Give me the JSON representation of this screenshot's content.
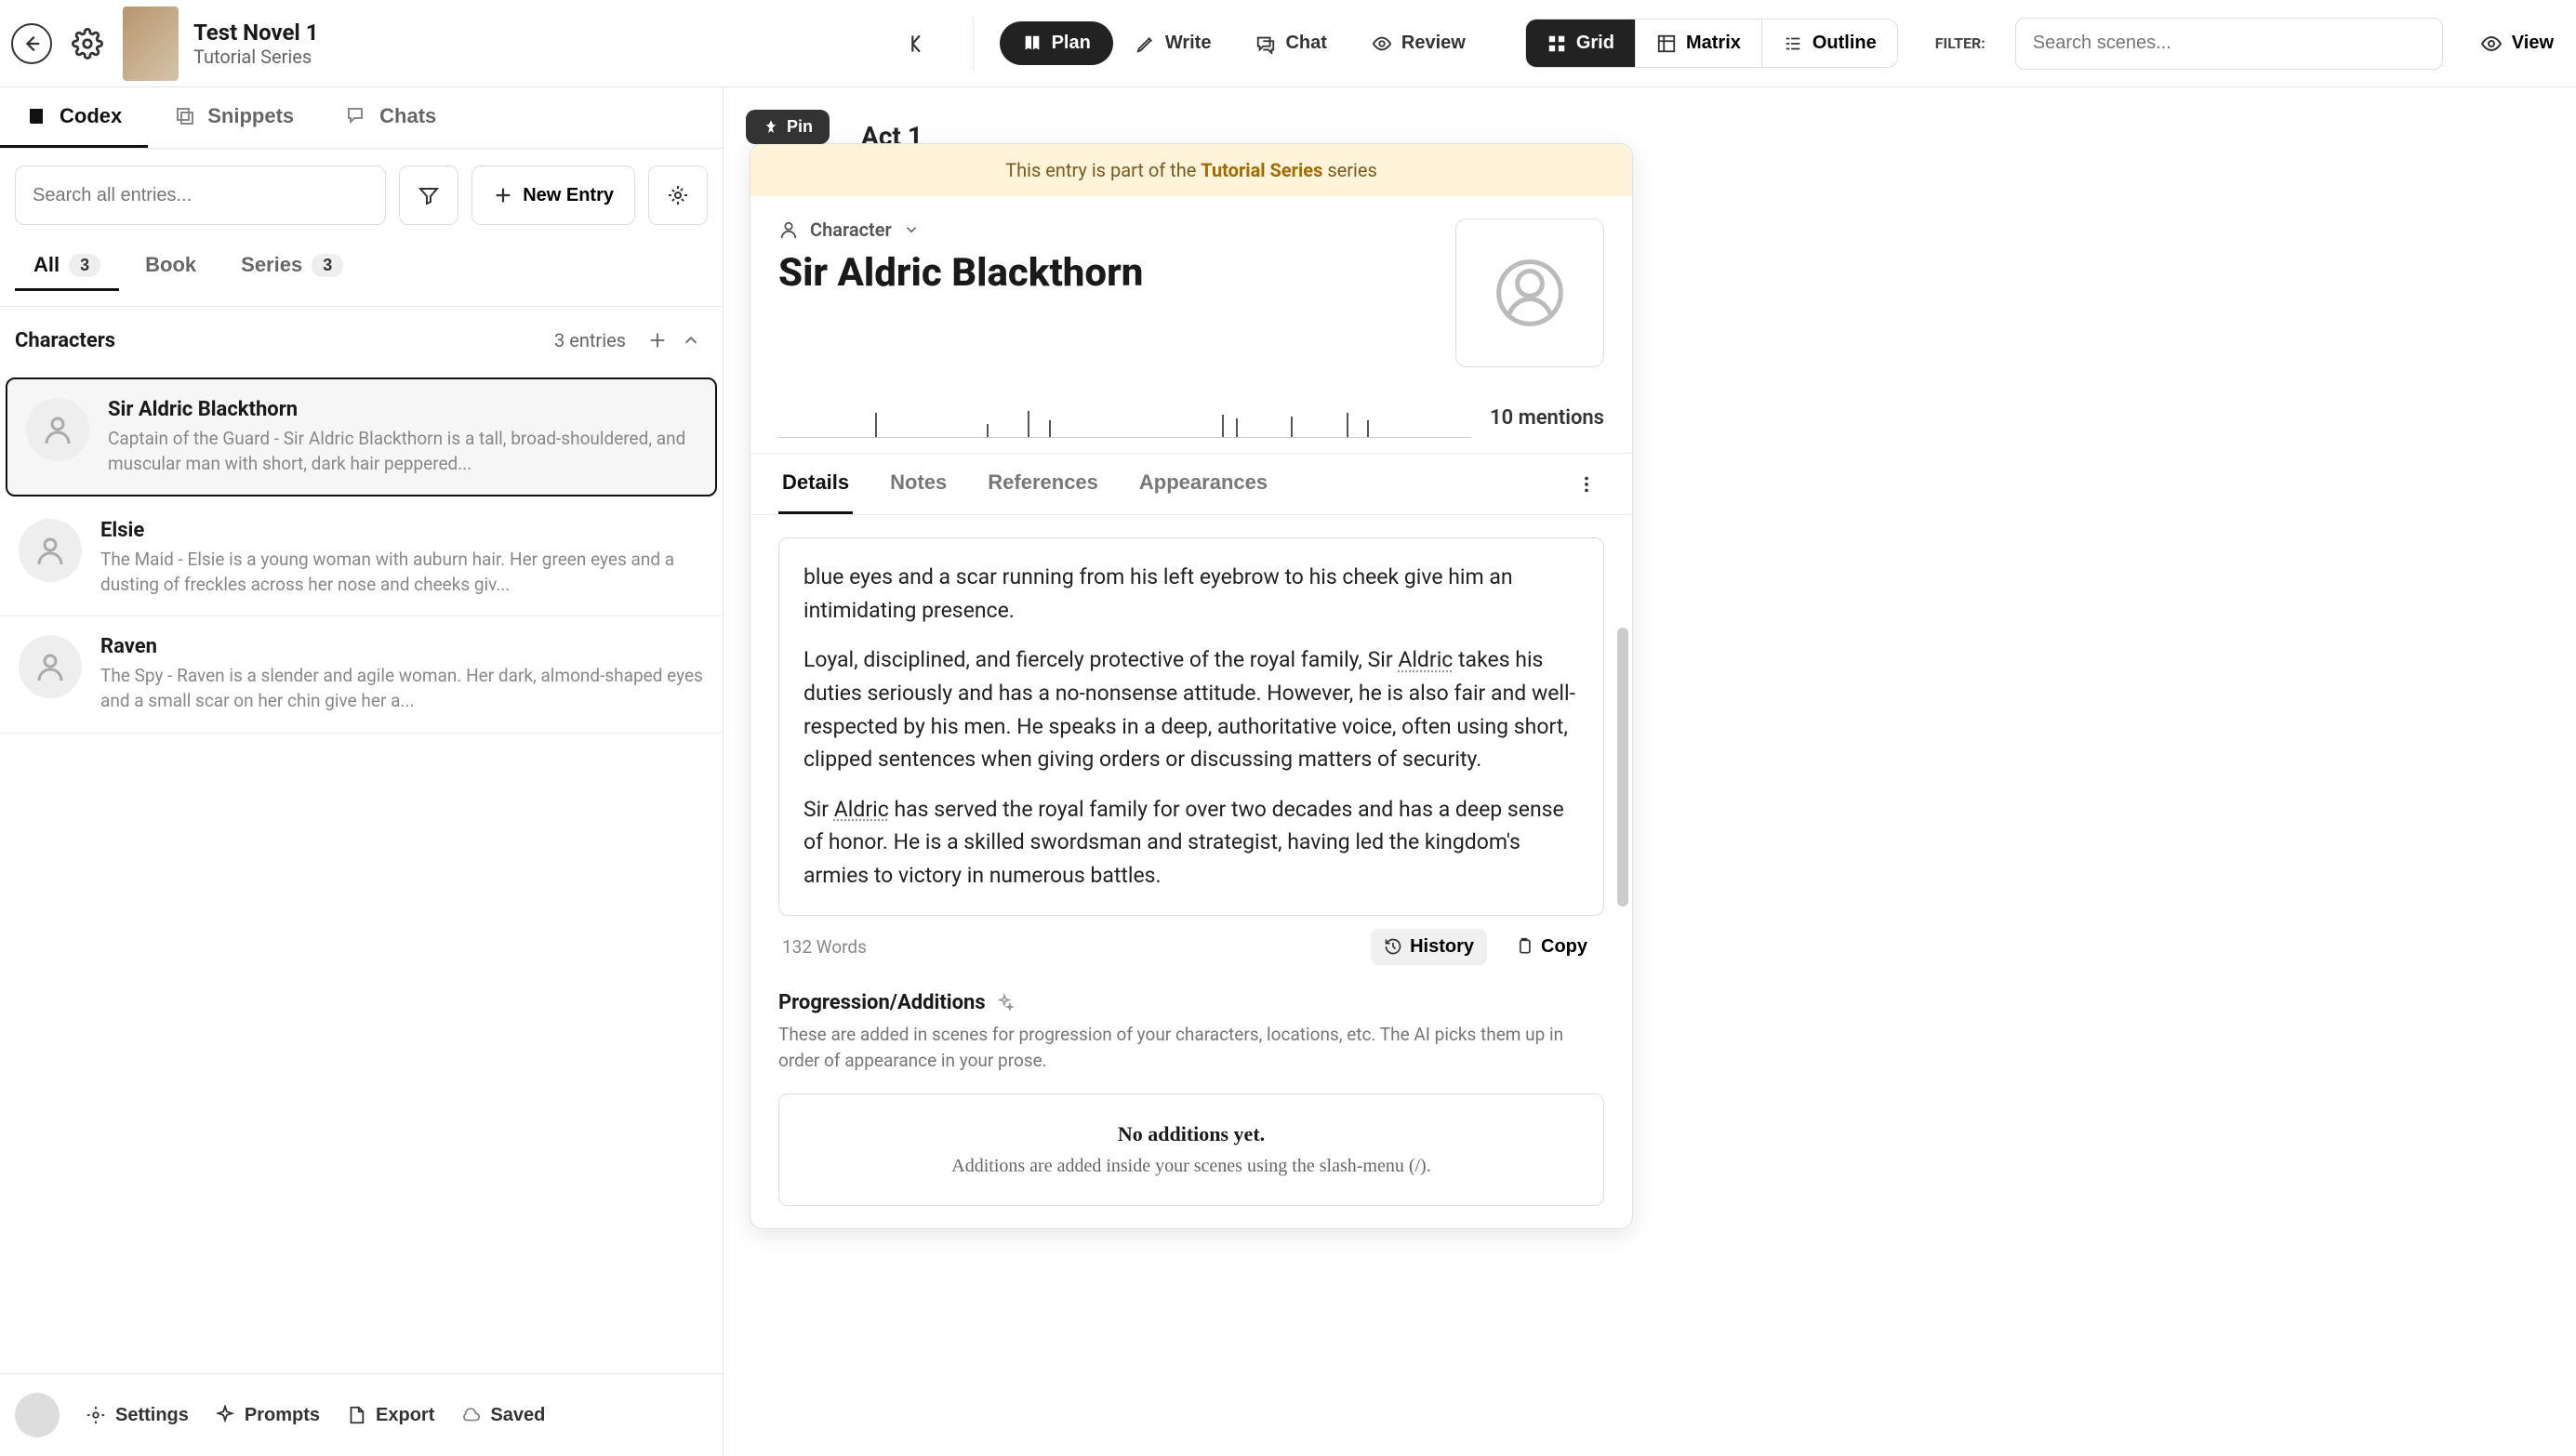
{
  "header": {
    "title": "Test Novel 1",
    "subtitle": "Tutorial Series"
  },
  "modes": {
    "plan": "Plan",
    "write": "Write",
    "chat": "Chat",
    "review": "Review"
  },
  "viewSeg": {
    "grid": "Grid",
    "matrix": "Matrix",
    "outline": "Outline"
  },
  "filterLabel": "FILTER:",
  "searchTopPlaceholder": "Search scenes...",
  "viewBtn": "View",
  "sideTabs": {
    "codex": "Codex",
    "snippets": "Snippets",
    "chats": "Chats"
  },
  "sideSearchPlaceholder": "Search all entries...",
  "newEntry": "New Entry",
  "scopeTabs": {
    "all": {
      "label": "All",
      "count": "3"
    },
    "book": {
      "label": "Book"
    },
    "series": {
      "label": "Series",
      "count": "3"
    }
  },
  "group": {
    "title": "Characters",
    "count": "3 entries"
  },
  "entries": [
    {
      "name": "Sir Aldric Blackthorn",
      "desc": "Captain of the Guard - Sir Aldric Blackthorn is a tall, broad-shouldered, and muscular man with short, dark hair peppered..."
    },
    {
      "name": "Elsie",
      "desc": "The Maid - Elsie is a young woman with auburn hair. Her green eyes and a dusting of freckles across her nose and cheeks giv..."
    },
    {
      "name": "Raven",
      "desc": "The Spy - Raven is a slender and agile woman. Her dark, almond-shaped eyes and a small scar on her chin give her a..."
    }
  ],
  "footer": {
    "settings": "Settings",
    "prompts": "Prompts",
    "export": "Export",
    "saved": "Saved"
  },
  "pin": "Pin",
  "actLabel": "Act 1",
  "banner": {
    "pre": "This entry is part of the ",
    "series": "Tutorial Series",
    "post": " series"
  },
  "card": {
    "type": "Character",
    "title": "Sir Aldric Blackthorn",
    "mentions": "10 mentions",
    "tabs": {
      "details": "Details",
      "notes": "Notes",
      "references": "References",
      "appearances": "Appearances"
    },
    "paragraphs": [
      "blue eyes and a scar running from his left eyebrow to his cheek give him an intimidating presence.",
      "Loyal, disciplined, and fiercely protective of the royal family, Sir Aldric takes his duties seriously and has a no-nonsense attitude. However, he is also fair and well-respected by his men. He speaks in a deep, authoritative voice, often using short, clipped sentences when giving orders or discussing matters of security.",
      "Sir Aldric has served the royal family for over two decades and has a deep sense of honor. He is a skilled swordsman and strategist, having led the kingdom's armies to victory in numerous battles."
    ],
    "wordCount": "132 Words",
    "history": "History",
    "copy": "Copy",
    "progTitle": "Progression/Additions",
    "progSub": "These are added in scenes for progression of your characters, locations, etc. The AI picks them up in order of appearance in your prose.",
    "progEmptyTitle": "No additions yet.",
    "progEmptySub": "Additions are added inside your scenes using the slash-menu (/)."
  }
}
